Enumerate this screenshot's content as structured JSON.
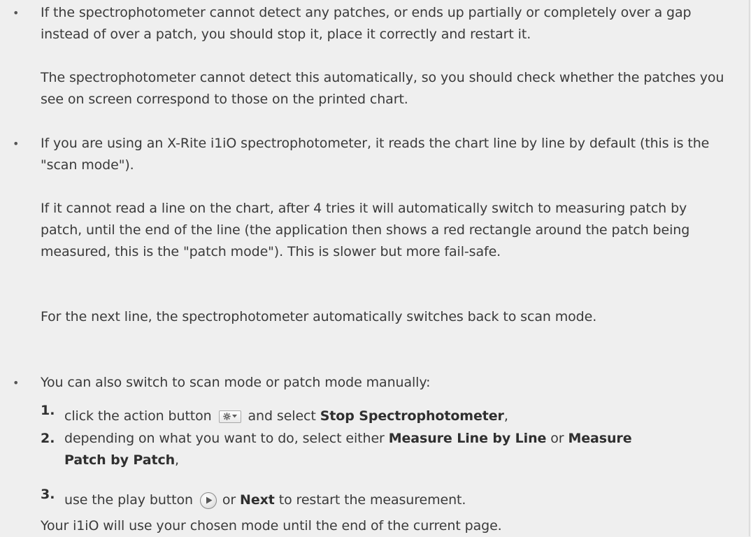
{
  "bullets": [
    {
      "symbol": "•",
      "paragraphs": [
        "If the spectrophotometer cannot detect any patches, or ends up partially or completely over a gap instead of over a patch, you should stop it, place it correctly and restart it.",
        "The spectrophotometer cannot detect this automatically, so you should check whether the patches you see on screen correspond to those on the printed chart."
      ]
    },
    {
      "symbol": "•",
      "paragraphs": [
        "If you are using an X-Rite i1iO spectrophotometer, it reads the chart line by line by default (this is the \"scan mode\").",
        "If it cannot read a line on the chart, after 4 tries it will automatically switch to measuring patch by patch, until the end of the line (the application then shows a red rectangle around the patch being measured, this is the \"patch mode\"). This is slower but more fail-safe.",
        "For the next line, the spectrophotometer automatically switches back to scan mode."
      ]
    },
    {
      "symbol": "•",
      "intro": "You can also switch to scan mode or patch mode manually:",
      "steps": [
        {
          "number": "1.",
          "before": "click the action button",
          "middle": "and select",
          "bold": "Stop Spectrophotometer",
          "after": ","
        },
        {
          "number": "2.",
          "before": "depending on what you want to do, select either",
          "bold1": "Measure Line by Line",
          "middle": "or",
          "bold2": "Measure",
          "line2_bold": "Patch by Patch",
          "line2_after": ","
        },
        {
          "number": "3.",
          "before": "use the play button",
          "middle": "or",
          "bold": "Next",
          "after": "to restart the measurement."
        }
      ],
      "closing": "Your i1iO will use your chosen mode until the end of the current page."
    }
  ],
  "icons": {
    "action_button": "gear-dropdown-icon",
    "play_button": "play-icon"
  }
}
